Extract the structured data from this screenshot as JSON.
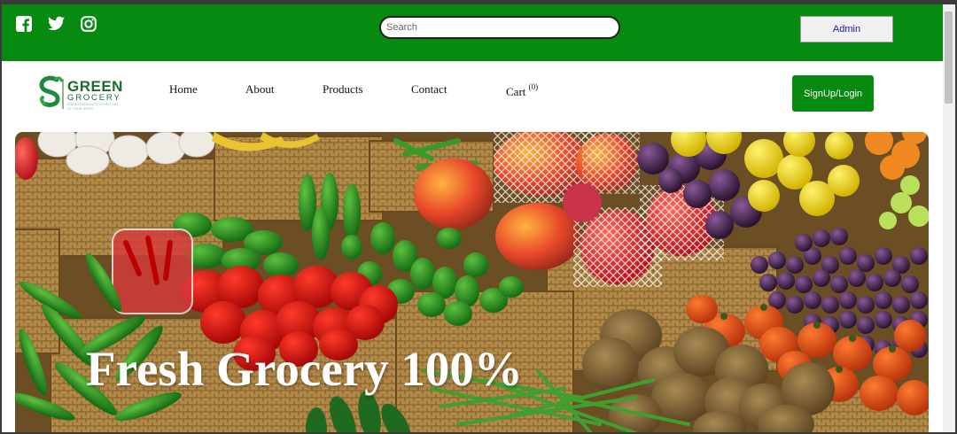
{
  "topbar": {
    "social_icons": [
      "facebook-icon",
      "twitter-icon",
      "instagram-icon"
    ],
    "search": {
      "placeholder": "Search",
      "value": ""
    },
    "admin_label": "Admin"
  },
  "logo": {
    "word": "GREEN",
    "sub": "GROCERY",
    "tagline": "FRESH PRODUCTS EVERY DAY AT YOUR DOOR"
  },
  "nav": {
    "links": [
      "Home",
      "About",
      "Products",
      "Contact"
    ],
    "cart_label": "Cart",
    "cart_count": "(0)"
  },
  "signup_label": "SignUp/Login",
  "hero": {
    "title": "Fresh Grocery 100%"
  },
  "colors": {
    "brand_green": "#068a10",
    "logo_green": "#1c6b2d",
    "admin_text": "#1a1aa8"
  }
}
